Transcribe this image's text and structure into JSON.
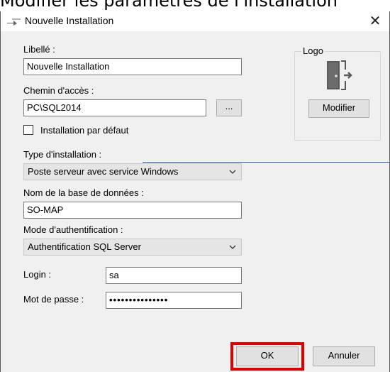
{
  "page_heading": "Modifier les paramètres de l'installation",
  "window": {
    "title": "Nouvelle Installation",
    "close_glyph": "✕"
  },
  "form": {
    "libelle_label": "Libellé :",
    "libelle_value": "Nouvelle Installation",
    "chemin_label": "Chemin d'accès :",
    "chemin_value": "PC\\SQL2014",
    "browse_label": "...",
    "default_checkbox_label": "Installation par défaut",
    "default_checked": false,
    "type_label": "Type d'installation :",
    "type_value": "Poste serveur avec service Windows",
    "db_label": "Nom de la base de données :",
    "db_value": "SO-MAP",
    "auth_label": "Mode d'authentification :",
    "auth_value": "Authentification SQL Server",
    "login_label": "Login :",
    "login_value": "sa",
    "password_label": "Mot de passe :",
    "password_value": "•••••••••••••••"
  },
  "logo": {
    "group_label": "Logo",
    "modify_label": "Modifier",
    "icon": "door-exit-icon"
  },
  "footer": {
    "ok_label": "OK",
    "cancel_label": "Annuler"
  },
  "colors": {
    "highlight": "#e00000",
    "accent_line": "#1f5fbf"
  }
}
